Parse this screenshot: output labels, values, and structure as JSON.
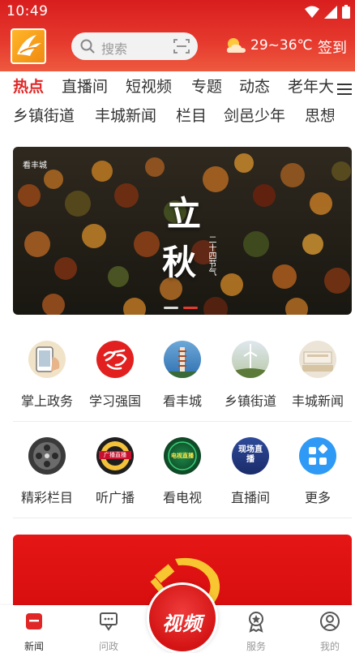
{
  "status_bar": {
    "time": "10:49"
  },
  "header": {
    "search_placeholder": "搜索",
    "weather": "29~36℃",
    "signin_label": "签到"
  },
  "tabs_row1": [
    "热点",
    "直播间",
    "短视频",
    "专题",
    "动态",
    "老年大"
  ],
  "tabs_row2": [
    "乡镇街道",
    "丰城新闻",
    "栏目",
    "剑邑少年",
    "思想"
  ],
  "banner": {
    "brand": "看丰城",
    "title_char_1": "立",
    "title_char_2": "秋",
    "subtitle": "二十四节气"
  },
  "grid_row1": [
    {
      "label": "掌上政务",
      "icon": "mobile-government-icon"
    },
    {
      "label": "学习强国",
      "icon": "xuexi-qiangguo-icon"
    },
    {
      "label": "看丰城",
      "icon": "pagoda-icon"
    },
    {
      "label": "乡镇街道",
      "icon": "wind-turbine-icon"
    },
    {
      "label": "丰城新闻",
      "icon": "news-studio-icon"
    }
  ],
  "grid_row2": [
    {
      "label": "精彩栏目",
      "icon": "film-reel-icon"
    },
    {
      "label": "听广播",
      "icon": "radio-broadcast-icon",
      "badge": "广播直播"
    },
    {
      "label": "看电视",
      "icon": "tv-live-icon",
      "badge": "电视直播"
    },
    {
      "label": "直播间",
      "icon": "live-room-icon",
      "badge": "现场直播"
    },
    {
      "label": "更多",
      "icon": "more-apps-icon"
    }
  ],
  "bottom_nav": {
    "news": "新闻",
    "wenzheng": "问政",
    "video": "视频",
    "service": "服务",
    "mine": "我的"
  },
  "colors": {
    "primary_red": "#e02626",
    "header_red": "#d81e1e",
    "more_blue": "#2e9af6"
  }
}
